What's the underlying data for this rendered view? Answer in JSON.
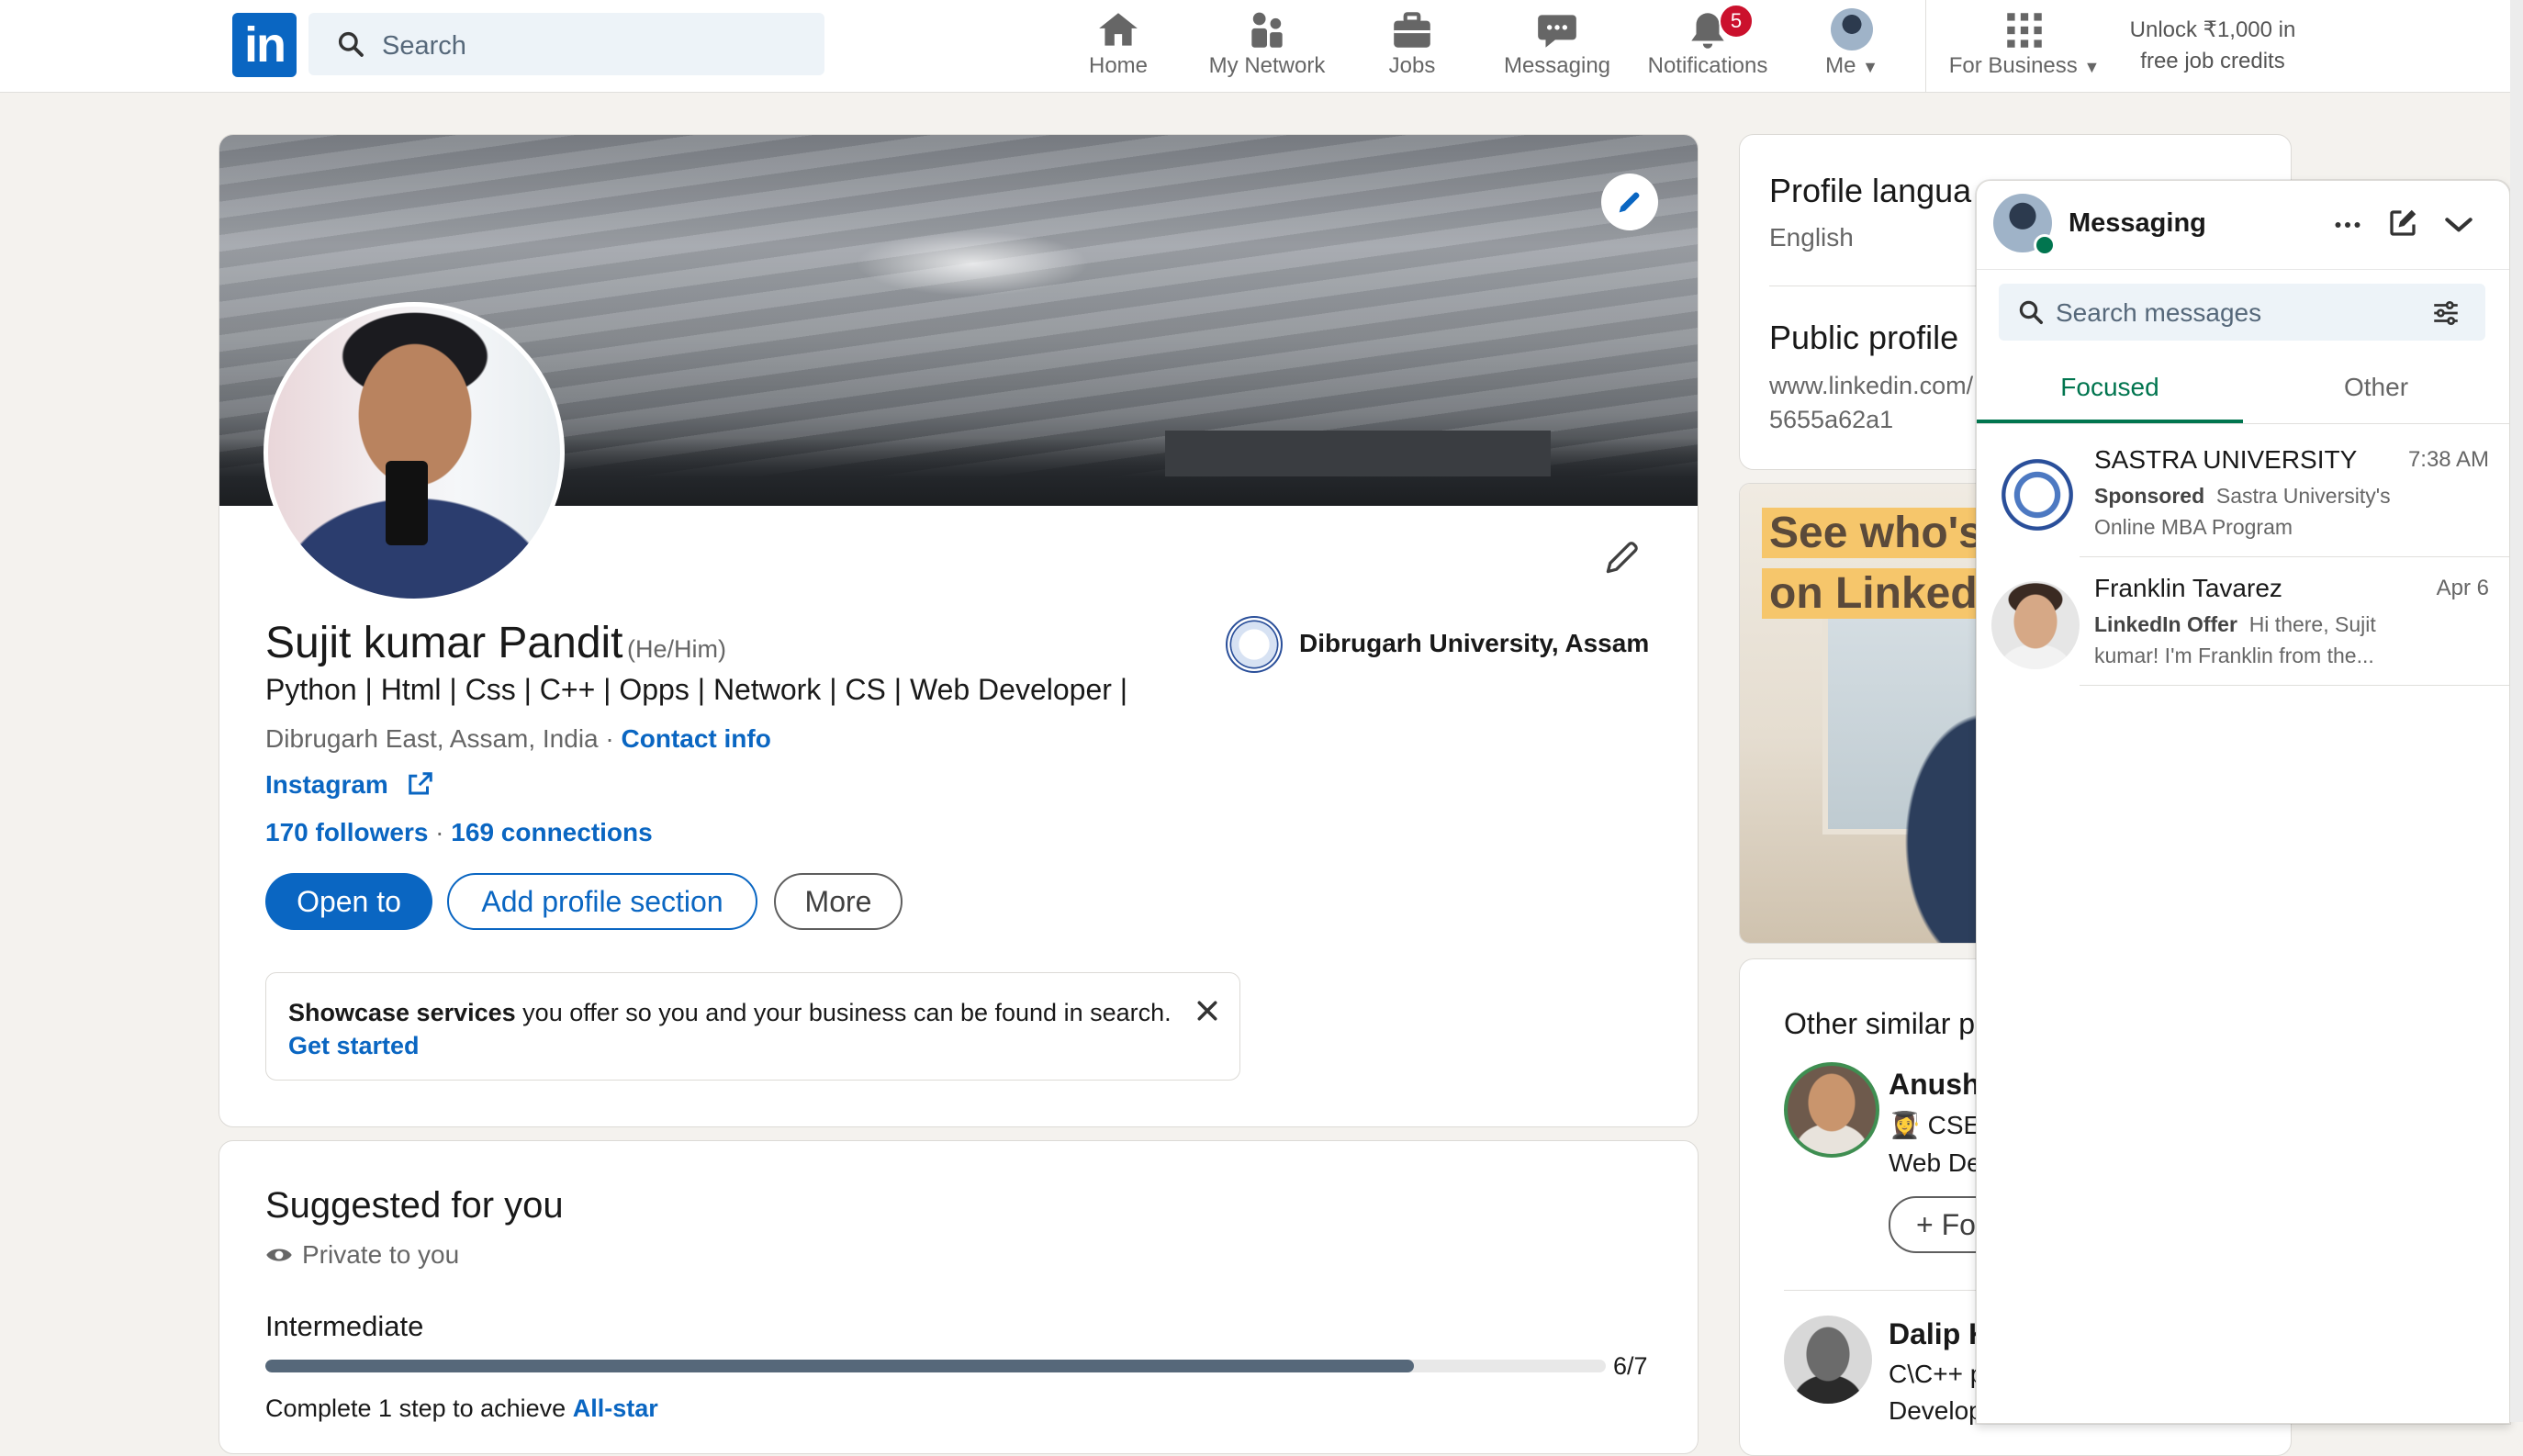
{
  "nav": {
    "logo_text": "in",
    "search_placeholder": "Search",
    "items": [
      {
        "label": "Home",
        "icon": "home-icon"
      },
      {
        "label": "My Network",
        "icon": "network-icon"
      },
      {
        "label": "Jobs",
        "icon": "briefcase-icon"
      },
      {
        "label": "Messaging",
        "icon": "chat-icon"
      },
      {
        "label": "Notifications",
        "icon": "bell-icon",
        "badge": "5"
      },
      {
        "label": "Me",
        "icon": "avatar"
      }
    ],
    "for_business": "For Business",
    "unlock_line1": "Unlock ₹1,000 in",
    "unlock_line2": "free job credits"
  },
  "profile": {
    "name": "Sujit kumar Pandit",
    "pronouns": "(He/Him)",
    "headline": "Python | Html | Css | C++ | Opps | Network | CS | Web Developer |",
    "location": "Dibrugarh East, Assam, India",
    "location_sep": " · ",
    "contact_info": "Contact info",
    "instagram": "Instagram",
    "followers": "170 followers",
    "connections_sep": " · ",
    "connections": "169 connections",
    "education": "Dibrugarh University, Assam",
    "buttons": {
      "open_to": "Open to",
      "add_section": "Add profile section",
      "more": "More"
    },
    "showcase": {
      "bold": "Showcase services",
      "rest": " you offer so you and your business can be found in search.",
      "link": "Get started"
    }
  },
  "suggested": {
    "title": "Suggested for you",
    "privacy": "Private to you",
    "level": "Intermediate",
    "progress": 0.857,
    "progress_text": "6/7",
    "complete_text": "Complete 1 step to achieve ",
    "complete_link": "All-star"
  },
  "sidebar": {
    "profile_language_title": "Profile langua",
    "profile_language_value": "English",
    "public_profile_title": "Public profile",
    "public_profile_url1": "www.linkedin.com/",
    "public_profile_url2": "5655a62a1",
    "ad_line1": "See who's",
    "ad_line2": "on LinkedI",
    "similar_title": "Other similar p",
    "people": [
      {
        "name": "Anushk",
        "line1": "CSE '",
        "line2": "Web De",
        "button": "+ Fo"
      },
      {
        "name": "Dalip K",
        "line1": "C\\C++ p",
        "line2": "Develop"
      }
    ]
  },
  "messaging": {
    "title": "Messaging",
    "search_placeholder": "Search messages",
    "tabs": [
      "Focused",
      "Other"
    ],
    "conversations": [
      {
        "name": "SASTRA UNIVERSITY",
        "time": "7:38 AM",
        "tag": "Sponsored",
        "line1": "Sastra University's",
        "line2": "Online MBA Program"
      },
      {
        "name": "Franklin Tavarez",
        "time": "Apr 6",
        "tag": "LinkedIn Offer",
        "line1": "Hi there, Sujit",
        "line2": "kumar! I'm Franklin from the..."
      }
    ]
  },
  "colors": {
    "accent": "#0a66c2",
    "badge": "#cb112d",
    "background": "#f4f2ee",
    "online": "#01754f"
  }
}
